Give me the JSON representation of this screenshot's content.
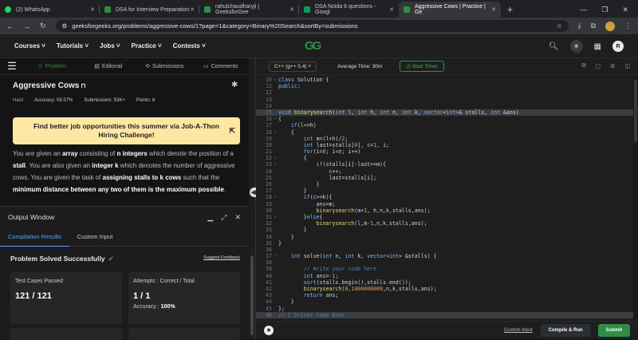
{
  "browser": {
    "tabs": [
      {
        "title": "(2) WhatsApp",
        "color": "#25d366",
        "active": false
      },
      {
        "title": "DSA for Interview Preparation",
        "color": "#2f8d46",
        "active": false
      },
      {
        "title": "rahulchaudharyji | GeeksforGee",
        "color": "#2f8d46",
        "active": false
      },
      {
        "title": "DSA Noida 6 questions - Googl",
        "color": "#0f9d58",
        "active": false
      },
      {
        "title": "Aggressive Cows | Practice | Ge",
        "color": "#2f8d46",
        "active": true
      }
    ],
    "url": "geeksforgeeks.org/problems/aggressive-cows/1?page=1&category=Binary%20Search&sortBy=submissions"
  },
  "nav": {
    "items": [
      "Courses",
      "Tutorials",
      "Jobs",
      "Practice",
      "Contests"
    ],
    "logo": "GG",
    "avatar": "R"
  },
  "problem_tabs": [
    "Problem",
    "Editorial",
    "Submissions",
    "Comments"
  ],
  "problem": {
    "title": "Aggressive Cows",
    "difficulty": "Hard",
    "accuracy": "Accuracy: 59.57%",
    "submissions": "Submissions: 53K+",
    "points": "Points: 8"
  },
  "banner": {
    "text": "Find better job opportunities this summer via Job-A-Thon Hiring Challenge!"
  },
  "output": {
    "title": "Output Window",
    "tabs": [
      "Compilation Results",
      "Custom Input"
    ],
    "status": "Problem Solved Successfully",
    "feedback": "Suggest Feedback",
    "test_label": "Test Cases Passed",
    "test_value": "121 / 121",
    "attempts_label": "Attempts : Correct / Total",
    "attempts_value": "1 / 1",
    "accuracy_label": "Accuracy :",
    "accuracy_value": "100%"
  },
  "editor": {
    "language": "C++ (g++ 5.4)",
    "avg_time": "Average Time: 30m",
    "timer": "Start Timer",
    "custom_input": "Custom Input",
    "compile_run": "Compile & Run",
    "submit": "Submit",
    "lines": [
      {
        "n": "10",
        "t": "class Solution {",
        "fold": "˅"
      },
      {
        "n": "11",
        "t": "public:"
      },
      {
        "n": "12",
        "t": ""
      },
      {
        "n": "13",
        "t": ""
      },
      {
        "n": "14",
        "t": ""
      },
      {
        "n": "15",
        "t": "void binarysearch(int l, int h, int n, int k, vector<int>& stalls, int &ans)",
        "hl": true
      },
      {
        "n": "16",
        "t": "{",
        "fold": "˅"
      },
      {
        "n": "17",
        "t": "    if(l<=h)"
      },
      {
        "n": "18",
        "t": "    {",
        "fold": "˅"
      },
      {
        "n": "19",
        "t": "        int m=(l+h)/2;"
      },
      {
        "n": "20",
        "t": "        int last=stalls[0], c=1, i;"
      },
      {
        "n": "21",
        "t": "        for(i=0; i<n; i++)"
      },
      {
        "n": "22",
        "t": "        {",
        "fold": "˅"
      },
      {
        "n": "23",
        "t": "            if(stalls[i]-last>=m){",
        "fold": "˅"
      },
      {
        "n": "24",
        "t": "                c++;"
      },
      {
        "n": "25",
        "t": "                last=stalls[i];"
      },
      {
        "n": "26",
        "t": "            }"
      },
      {
        "n": "27",
        "t": "        }"
      },
      {
        "n": "28",
        "t": "        if(c>=k){",
        "fold": "˅"
      },
      {
        "n": "29",
        "t": "            ans=m;"
      },
      {
        "n": "30",
        "t": "            binarysearch(m+1, h,n,k,stalls,ans);"
      },
      {
        "n": "31",
        "t": "        }else{",
        "fold": "˅"
      },
      {
        "n": "32",
        "t": "            binarysearch(l,m-1,n,k,stalls,ans);"
      },
      {
        "n": "33",
        "t": "        }"
      },
      {
        "n": "34",
        "t": "    }"
      },
      {
        "n": "35",
        "t": "}"
      },
      {
        "n": "36",
        "t": ""
      },
      {
        "n": "37",
        "t": "    int solve(int n, int k, vector<int> &stalls) {",
        "fold": "˅"
      },
      {
        "n": "38",
        "t": ""
      },
      {
        "n": "39",
        "t": "        // Write your code here"
      },
      {
        "n": "40",
        "t": "        int ans=-1;"
      },
      {
        "n": "41",
        "t": "        sort(stalls.begin(),stalls.end());"
      },
      {
        "n": "42",
        "t": "        binarysearch(0,1000000000,n,k,stalls,ans);"
      },
      {
        "n": "43",
        "t": "        return ans;"
      },
      {
        "n": "44",
        "t": "    }"
      },
      {
        "n": "45",
        "t": "};"
      },
      {
        "n": "46",
        "t": "// } Driver Code Ends",
        "fold": "›",
        "hl": true
      }
    ]
  }
}
